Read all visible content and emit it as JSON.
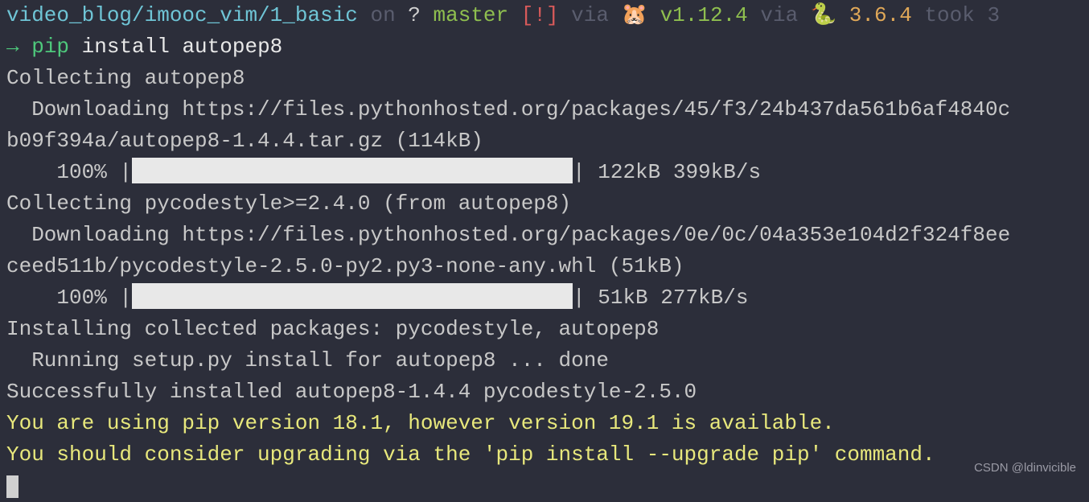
{
  "header": {
    "path": "video_blog/imooc_vim/1_basic",
    "on": "on",
    "branch": "master",
    "warn": "[!]",
    "via1": "via",
    "ver1": "v1.12.4",
    "via2": "via",
    "ver2": "3.6.4",
    "took": "took",
    "tail": "3"
  },
  "prompt": {
    "arrow": "→ ",
    "cmd": "pip",
    "args": " install autopep8"
  },
  "lines": {
    "collecting1": "Collecting autopep8",
    "download1a": "  Downloading https://files.pythonhosted.org/packages/45/f3/24b437da561b6af4840c",
    "download1b": "b09f394a/autopep8-1.4.4.tar.gz (114kB)",
    "progress1_pre": "    100% |",
    "progress1_post": "| 122kB 399kB/s",
    "collecting2": "Collecting pycodestyle>=2.4.0 (from autopep8)",
    "download2a": "  Downloading https://files.pythonhosted.org/packages/0e/0c/04a353e104d2f324f8ee",
    "download2b": "ceed511b/pycodestyle-2.5.0-py2.py3-none-any.whl (51kB)",
    "progress2_pre": "    100% |",
    "progress2_post": "| 51kB 277kB/s",
    "installing": "Installing collected packages: pycodestyle, autopep8",
    "running": "  Running setup.py install for autopep8 ... done",
    "success": "Successfully installed autopep8-1.4.4 pycodestyle-2.5.0",
    "warn1": "You are using pip version 18.1, however version 19.1 is available.",
    "warn2": "You should consider upgrading via the 'pip install --upgrade pip' command."
  },
  "watermark": "CSDN @ldinvicible"
}
